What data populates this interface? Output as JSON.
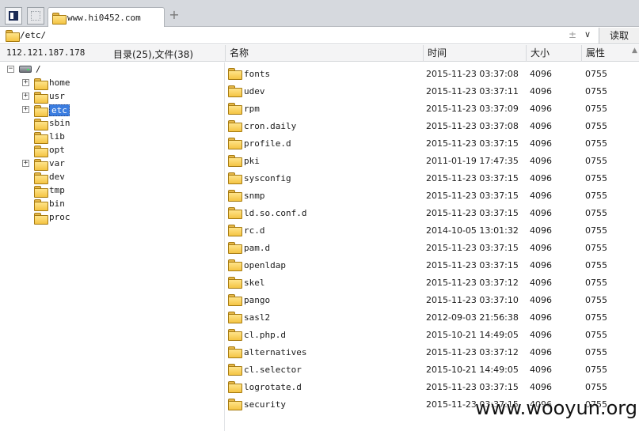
{
  "tabbar": {
    "tab_title": "www.hi0452.com",
    "new_tab_glyph": "+"
  },
  "pathbar": {
    "path": "/etc/",
    "sort_glyph": "±",
    "dropdown_glyph": "∨",
    "read_label": "读取"
  },
  "header": {
    "ip": "112.121.187.178",
    "counts": "目录(25),文件(38)",
    "col_name": "名称",
    "col_time": "时间",
    "col_size": "大小",
    "col_attr": "属性"
  },
  "tree": {
    "root": "/",
    "nodes": [
      {
        "label": "home",
        "expandable": true
      },
      {
        "label": "usr",
        "expandable": true
      },
      {
        "label": "etc",
        "expandable": true,
        "selected": true
      },
      {
        "label": "sbin",
        "expandable": false
      },
      {
        "label": "lib",
        "expandable": false
      },
      {
        "label": "opt",
        "expandable": false
      },
      {
        "label": "var",
        "expandable": true
      },
      {
        "label": "dev",
        "expandable": false
      },
      {
        "label": "tmp",
        "expandable": false
      },
      {
        "label": "bin",
        "expandable": false
      },
      {
        "label": "proc",
        "expandable": false
      }
    ]
  },
  "files": [
    {
      "name": "fonts",
      "time": "2015-11-23 03:37:08",
      "size": "4096",
      "attr": "0755"
    },
    {
      "name": "udev",
      "time": "2015-11-23 03:37:11",
      "size": "4096",
      "attr": "0755"
    },
    {
      "name": "rpm",
      "time": "2015-11-23 03:37:09",
      "size": "4096",
      "attr": "0755"
    },
    {
      "name": "cron.daily",
      "time": "2015-11-23 03:37:08",
      "size": "4096",
      "attr": "0755"
    },
    {
      "name": "profile.d",
      "time": "2015-11-23 03:37:15",
      "size": "4096",
      "attr": "0755"
    },
    {
      "name": "pki",
      "time": "2011-01-19 17:47:35",
      "size": "4096",
      "attr": "0755"
    },
    {
      "name": "sysconfig",
      "time": "2015-11-23 03:37:15",
      "size": "4096",
      "attr": "0755"
    },
    {
      "name": "snmp",
      "time": "2015-11-23 03:37:15",
      "size": "4096",
      "attr": "0755"
    },
    {
      "name": "ld.so.conf.d",
      "time": "2015-11-23 03:37:15",
      "size": "4096",
      "attr": "0755"
    },
    {
      "name": "rc.d",
      "time": "2014-10-05 13:01:32",
      "size": "4096",
      "attr": "0755"
    },
    {
      "name": "pam.d",
      "time": "2015-11-23 03:37:15",
      "size": "4096",
      "attr": "0755"
    },
    {
      "name": "openldap",
      "time": "2015-11-23 03:37:15",
      "size": "4096",
      "attr": "0755"
    },
    {
      "name": "skel",
      "time": "2015-11-23 03:37:12",
      "size": "4096",
      "attr": "0755"
    },
    {
      "name": "pango",
      "time": "2015-11-23 03:37:10",
      "size": "4096",
      "attr": "0755"
    },
    {
      "name": "sasl2",
      "time": "2012-09-03 21:56:38",
      "size": "4096",
      "attr": "0755"
    },
    {
      "name": "cl.php.d",
      "time": "2015-10-21 14:49:05",
      "size": "4096",
      "attr": "0755"
    },
    {
      "name": "alternatives",
      "time": "2015-11-23 03:37:12",
      "size": "4096",
      "attr": "0755"
    },
    {
      "name": "cl.selector",
      "time": "2015-10-21 14:49:05",
      "size": "4096",
      "attr": "0755"
    },
    {
      "name": "logrotate.d",
      "time": "2015-11-23 03:37:15",
      "size": "4096",
      "attr": "0755"
    },
    {
      "name": "security",
      "time": "2015-11-23 03:37:15",
      "size": "4096",
      "attr": "0755"
    }
  ],
  "watermark": "www.wooyun.org"
}
